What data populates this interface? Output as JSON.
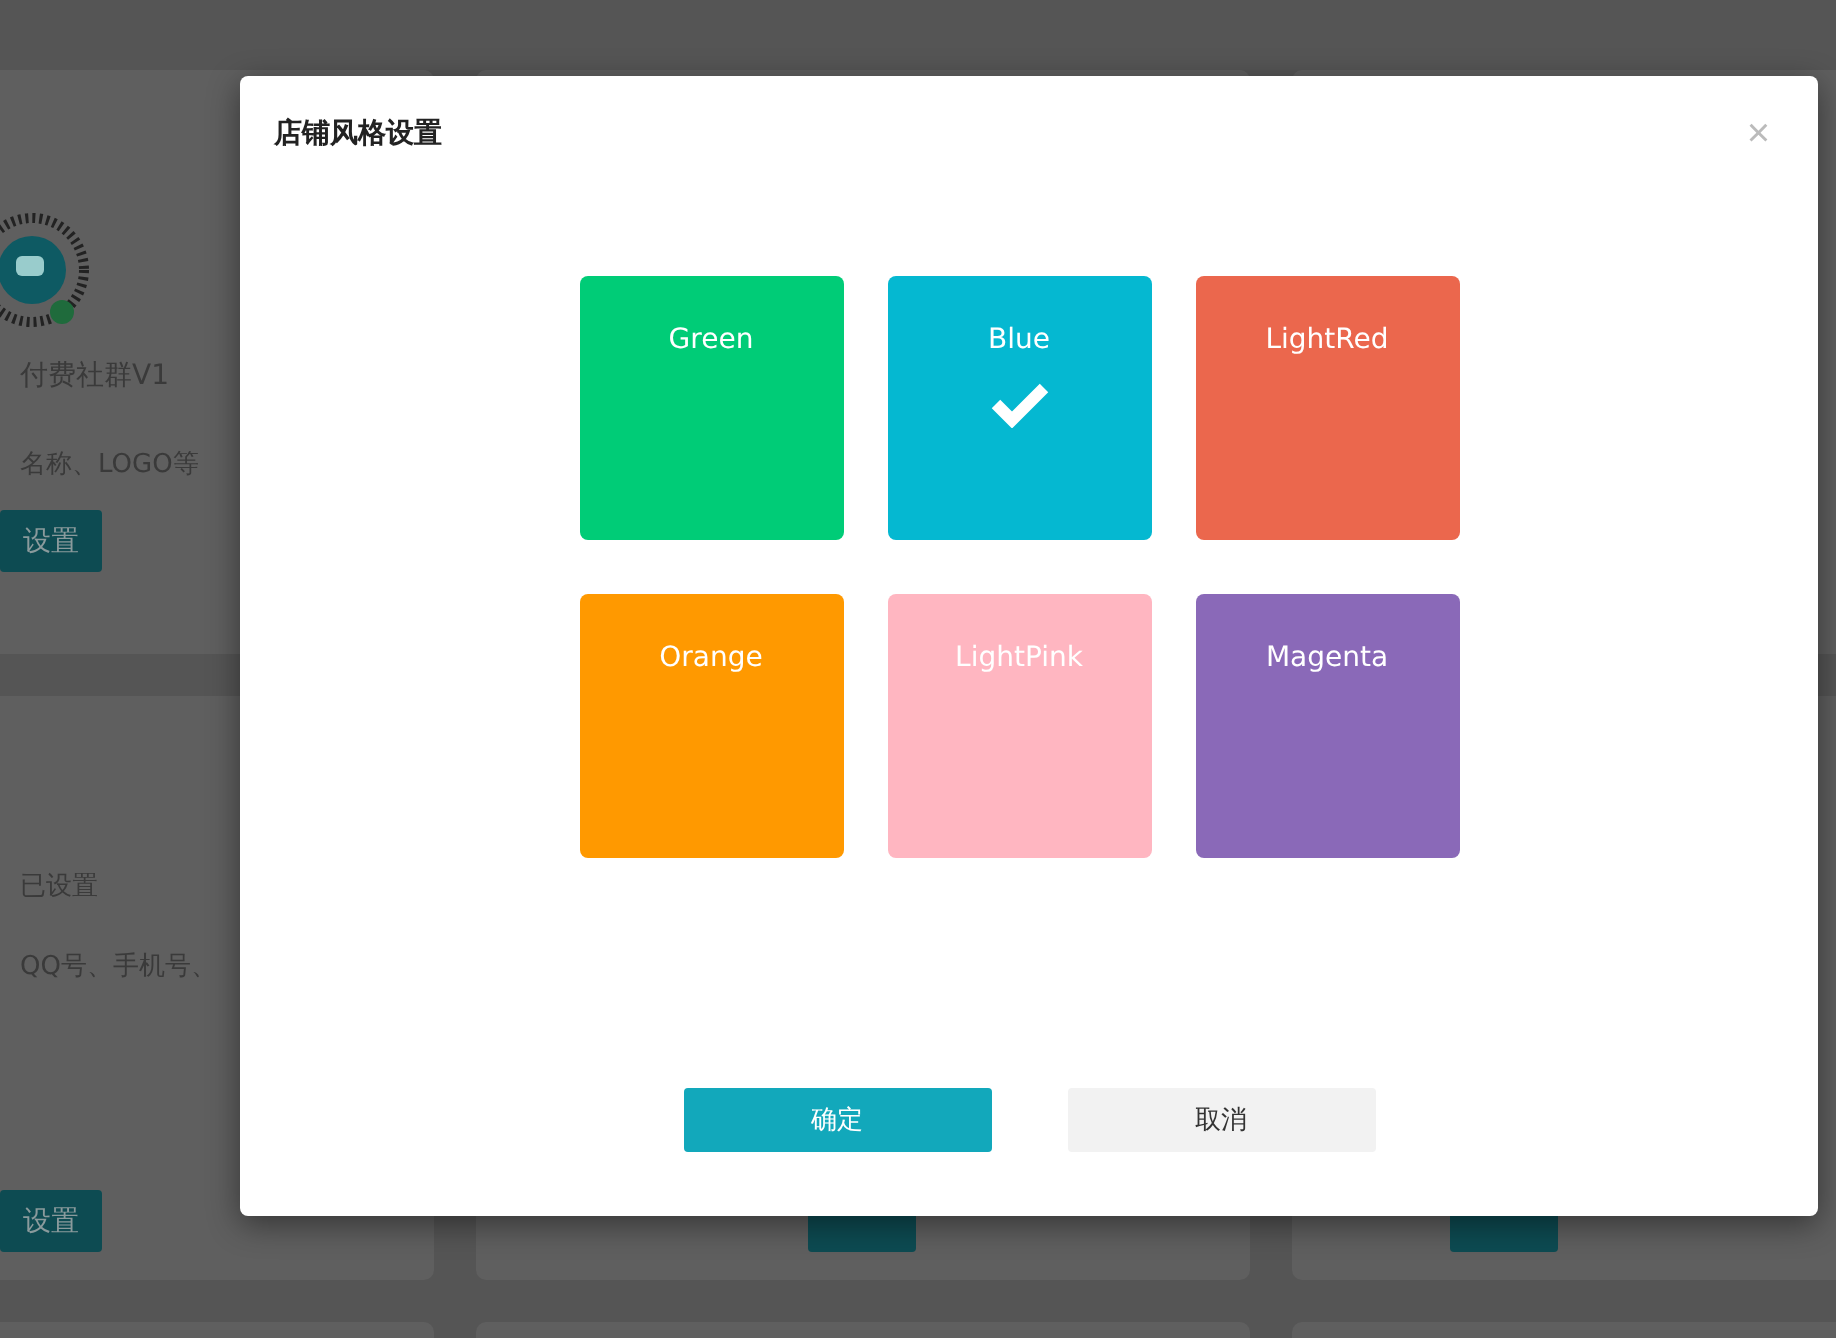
{
  "background": {
    "cards": [
      {
        "kind": "logo",
        "name": "付费社群V1",
        "description": "名称、LOGO等",
        "button": "设置"
      },
      {
        "kind": "contact",
        "status": "已设置",
        "description": "QQ号、手机号、",
        "button": "设置"
      }
    ]
  },
  "dialog": {
    "title": "店铺风格设置",
    "close": "×",
    "themes": [
      {
        "name": "Green",
        "color": "#00cc77",
        "selected": false
      },
      {
        "name": "Blue",
        "color": "#05b8d1",
        "selected": true
      },
      {
        "name": "LightRed",
        "color": "#eb674d",
        "selected": false
      },
      {
        "name": "Orange",
        "color": "#ff9900",
        "selected": false
      },
      {
        "name": "LightPink",
        "color": "#ffb6c1",
        "selected": false
      },
      {
        "name": "Magenta",
        "color": "#8a69b8",
        "selected": false
      }
    ],
    "buttons": [
      {
        "kind": "primary",
        "label": "确定"
      },
      {
        "kind": "secondary",
        "label": "取消"
      }
    ]
  }
}
